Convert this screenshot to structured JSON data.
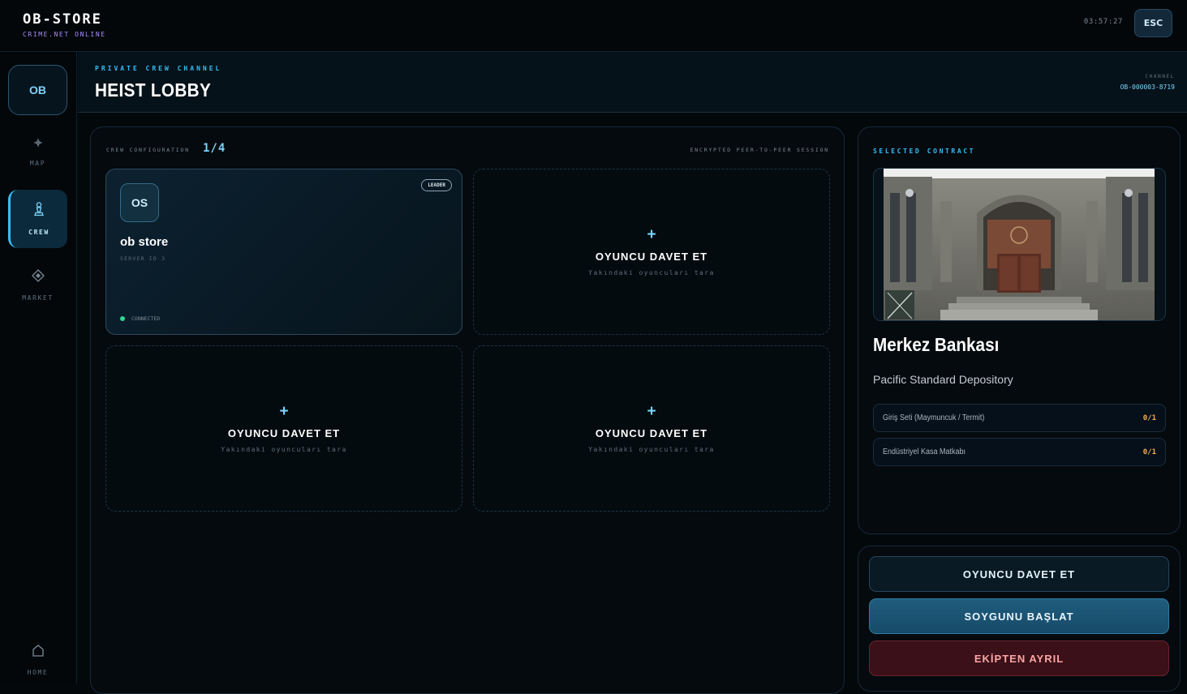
{
  "topbar": {
    "brand_title": "OB-STORE",
    "brand_subtitle": "CRIME.NET ONLINE",
    "clock": "03:57:27",
    "esc_label": "ESC"
  },
  "sidebar": {
    "avatar_initials": "OB",
    "items": [
      {
        "label": "MAP",
        "icon": "crosshair-icon"
      },
      {
        "label": "CREW",
        "icon": "chess-pawn-icon",
        "active": true
      },
      {
        "label": "MARKET",
        "icon": "diamond-icon"
      },
      {
        "label": "HOME",
        "icon": "home-icon"
      }
    ]
  },
  "header": {
    "eyebrow": "PRIVATE CREW CHANNEL",
    "title": "HEIST LOBBY",
    "channel_label": "CHANNEL",
    "channel_value": "OB-000003-8719"
  },
  "crew": {
    "config_label": "CREW CONFIGURATION",
    "count": "1/4",
    "session_label": "ENCRYPTED PEER-TO-PEER SESSION",
    "member": {
      "initials": "OS",
      "name": "ob store",
      "server_id": "SERVER ID 3",
      "badge": "LEADER",
      "status": "CONNECTED"
    },
    "empty_slot": {
      "plus": "+",
      "label": "OYUNCU DAVET ET",
      "sub": "Yakındaki oyuncuları tara"
    }
  },
  "contract": {
    "eyebrow": "SELECTED CONTRACT",
    "title": "Merkez Bankası",
    "subtitle": "Pacific Standard Depository",
    "requirements": [
      {
        "name": "Giriş Seti (Maymuncuk / Termit)",
        "value": "0/1"
      },
      {
        "name": "Endüstriyel Kasa Matkabı",
        "value": "0/1"
      }
    ]
  },
  "actions": {
    "invite": "OYUNCU DAVET ET",
    "start": "SOYGUNU BAŞLAT",
    "leave": "EKİPTEN AYRIL"
  },
  "colors": {
    "accent": "#38bdf8",
    "brand_sub": "#a78bfa",
    "status_ok": "#34d399",
    "req_value": "#f6ad55",
    "danger": "#fca5a5"
  }
}
